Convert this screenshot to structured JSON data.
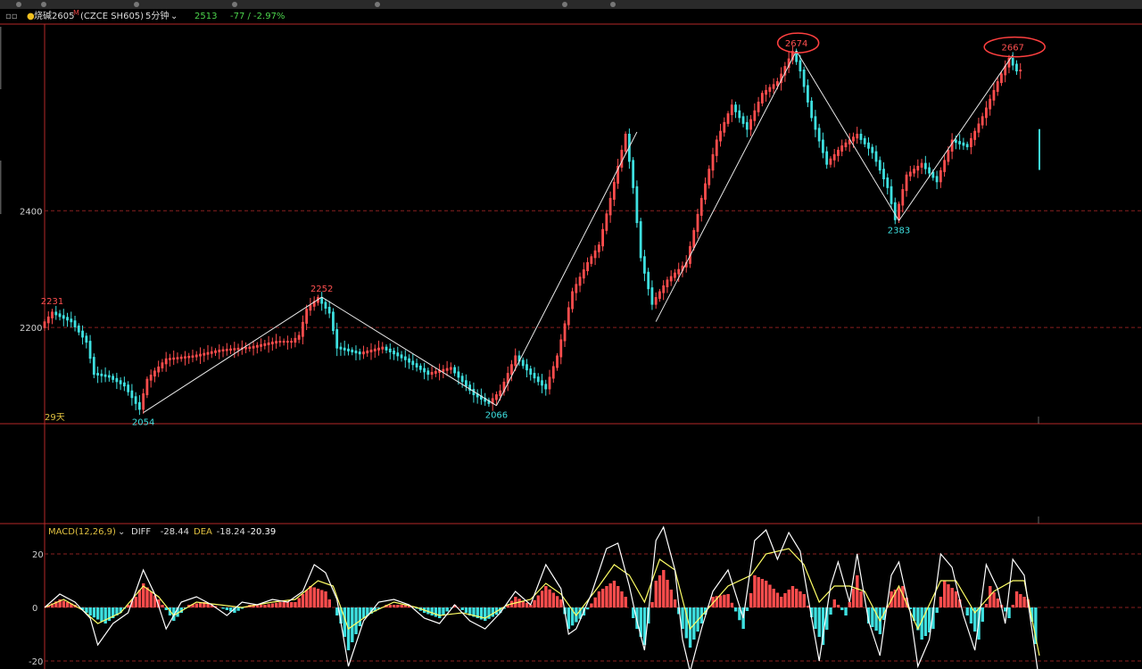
{
  "header": {
    "symbol": "烧碱2605",
    "warn_mark": "M",
    "code": "(CZCE SH605)",
    "period": "5分钟",
    "last_price": "2513",
    "change": "-77 / -2.97%"
  },
  "colors": {
    "up": "#ff4d4d",
    "down": "#3ee0e0",
    "diff_line": "#ffffff",
    "dea_line": "#ffff66",
    "border": "#b42828",
    "grid": "#8a1f1f"
  },
  "chart_data": [
    {
      "type": "candlestick",
      "title": "",
      "ylim": [
        2035,
        2720
      ],
      "y_ticks": [
        "2400",
        "2200"
      ],
      "note_label": "29天",
      "price_path": [
        [
          0,
          2200
        ],
        [
          3,
          2225
        ],
        [
          8,
          2210
        ],
        [
          12,
          2175
        ],
        [
          14,
          2120
        ],
        [
          18,
          2115
        ],
        [
          22,
          2100
        ],
        [
          26,
          2060
        ],
        [
          28,
          2110
        ],
        [
          33,
          2145
        ],
        [
          40,
          2150
        ],
        [
          47,
          2160
        ],
        [
          55,
          2165
        ],
        [
          62,
          2175
        ],
        [
          66,
          2175
        ],
        [
          68,
          2185
        ],
        [
          70,
          2230
        ],
        [
          73,
          2250
        ],
        [
          76,
          2225
        ],
        [
          78,
          2165
        ],
        [
          84,
          2155
        ],
        [
          90,
          2165
        ],
        [
          96,
          2145
        ],
        [
          102,
          2120
        ],
        [
          108,
          2130
        ],
        [
          114,
          2085
        ],
        [
          118,
          2070
        ],
        [
          121,
          2090
        ],
        [
          125,
          2150
        ],
        [
          129,
          2120
        ],
        [
          133,
          2095
        ],
        [
          136,
          2150
        ],
        [
          140,
          2260
        ],
        [
          144,
          2310
        ],
        [
          147,
          2340
        ],
        [
          150,
          2420
        ],
        [
          154,
          2530
        ],
        [
          156,
          2440
        ],
        [
          158,
          2320
        ],
        [
          161,
          2240
        ],
        [
          165,
          2280
        ],
        [
          170,
          2310
        ],
        [
          174,
          2420
        ],
        [
          178,
          2520
        ],
        [
          182,
          2580
        ],
        [
          186,
          2540
        ],
        [
          190,
          2600
        ],
        [
          194,
          2620
        ],
        [
          198,
          2672
        ],
        [
          200,
          2640
        ],
        [
          203,
          2560
        ],
        [
          207,
          2480
        ],
        [
          211,
          2510
        ],
        [
          215,
          2530
        ],
        [
          219,
          2500
        ],
        [
          223,
          2440
        ],
        [
          225,
          2385
        ],
        [
          228,
          2460
        ],
        [
          232,
          2480
        ],
        [
          236,
          2450
        ],
        [
          240,
          2520
        ],
        [
          244,
          2510
        ],
        [
          248,
          2560
        ],
        [
          252,
          2620
        ],
        [
          255,
          2660
        ],
        [
          257,
          2640
        ]
      ],
      "gap_point": [
        262,
        2510
      ],
      "markers": [
        {
          "label": "2231",
          "x": 2,
          "y": 2231,
          "kind": "high"
        },
        {
          "label": "2054",
          "x": 26,
          "y": 2054,
          "kind": "low"
        },
        {
          "label": "2252",
          "x": 73,
          "y": 2252,
          "kind": "high"
        },
        {
          "label": "2066",
          "x": 119,
          "y": 2066,
          "kind": "low"
        },
        {
          "label": "2674",
          "x": 198,
          "y": 2674,
          "kind": "high",
          "circled": true
        },
        {
          "label": "2383",
          "x": 225,
          "y": 2383,
          "kind": "low"
        },
        {
          "label": "2667",
          "x": 255,
          "y": 2667,
          "kind": "high",
          "circled": true
        }
      ],
      "trendlines": [
        [
          [
            26,
            2054
          ],
          [
            73,
            2252
          ]
        ],
        [
          [
            73,
            2252
          ],
          [
            119,
            2066
          ]
        ],
        [
          [
            119,
            2066
          ],
          [
            156,
            2535
          ]
        ],
        [
          [
            161,
            2210
          ],
          [
            198,
            2674
          ]
        ],
        [
          [
            198,
            2674
          ],
          [
            225,
            2383
          ]
        ],
        [
          [
            225,
            2383
          ],
          [
            255,
            2667
          ]
        ]
      ]
    },
    {
      "type": "line",
      "title": "MACD(12,26,9)",
      "legend": [
        {
          "name": "DIFF",
          "value": "-28.44"
        },
        {
          "name": "DEA",
          "value": "-18.24"
        },
        {
          "name": "",
          "value": "-20.39"
        }
      ],
      "ylim": [
        -23,
        31
      ],
      "y_ticks": [
        "20",
        "0",
        "-20"
      ],
      "diff_path": [
        [
          0,
          0
        ],
        [
          4,
          5
        ],
        [
          8,
          2
        ],
        [
          12,
          -4
        ],
        [
          14,
          -14
        ],
        [
          18,
          -6
        ],
        [
          22,
          -2
        ],
        [
          26,
          14
        ],
        [
          29,
          5
        ],
        [
          32,
          -8
        ],
        [
          36,
          2
        ],
        [
          40,
          4
        ],
        [
          44,
          1
        ],
        [
          48,
          -3
        ],
        [
          52,
          2
        ],
        [
          56,
          1
        ],
        [
          60,
          3
        ],
        [
          64,
          2
        ],
        [
          68,
          6
        ],
        [
          71,
          16
        ],
        [
          74,
          13
        ],
        [
          77,
          3
        ],
        [
          80,
          -22
        ],
        [
          84,
          -5
        ],
        [
          88,
          2
        ],
        [
          92,
          3
        ],
        [
          96,
          1
        ],
        [
          100,
          -4
        ],
        [
          104,
          -6
        ],
        [
          108,
          1
        ],
        [
          112,
          -5
        ],
        [
          116,
          -8
        ],
        [
          120,
          -2
        ],
        [
          124,
          6
        ],
        [
          128,
          1
        ],
        [
          132,
          16
        ],
        [
          136,
          7
        ],
        [
          138,
          -10
        ],
        [
          140,
          -8
        ],
        [
          144,
          5
        ],
        [
          148,
          22
        ],
        [
          151,
          24
        ],
        [
          154,
          8
        ],
        [
          156,
          -5
        ],
        [
          158,
          -16
        ],
        [
          161,
          25
        ],
        [
          163,
          30
        ],
        [
          166,
          14
        ],
        [
          168,
          -12
        ],
        [
          170,
          -24
        ],
        [
          173,
          -8
        ],
        [
          176,
          6
        ],
        [
          180,
          14
        ],
        [
          184,
          -4
        ],
        [
          187,
          25
        ],
        [
          190,
          29
        ],
        [
          193,
          18
        ],
        [
          196,
          28
        ],
        [
          199,
          21
        ],
        [
          202,
          -4
        ],
        [
          204,
          -20
        ],
        [
          207,
          8
        ],
        [
          209,
          17
        ],
        [
          212,
          2
        ],
        [
          214,
          20
        ],
        [
          217,
          -5
        ],
        [
          220,
          -18
        ],
        [
          223,
          12
        ],
        [
          225,
          17
        ],
        [
          228,
          -2
        ],
        [
          230,
          -22
        ],
        [
          233,
          -12
        ],
        [
          236,
          20
        ],
        [
          239,
          15
        ],
        [
          242,
          -3
        ],
        [
          245,
          -16
        ],
        [
          248,
          16
        ],
        [
          251,
          7
        ],
        [
          253,
          -6
        ],
        [
          255,
          18
        ],
        [
          258,
          12
        ],
        [
          262,
          -28
        ]
      ],
      "dea_path": [
        [
          0,
          0
        ],
        [
          5,
          3
        ],
        [
          10,
          -1
        ],
        [
          14,
          -6
        ],
        [
          20,
          -2
        ],
        [
          26,
          8
        ],
        [
          30,
          4
        ],
        [
          34,
          -3
        ],
        [
          40,
          2
        ],
        [
          46,
          1
        ],
        [
          52,
          0
        ],
        [
          60,
          2
        ],
        [
          66,
          3
        ],
        [
          72,
          10
        ],
        [
          76,
          8
        ],
        [
          80,
          -8
        ],
        [
          86,
          -2
        ],
        [
          92,
          2
        ],
        [
          98,
          0
        ],
        [
          104,
          -3
        ],
        [
          110,
          -2
        ],
        [
          116,
          -4
        ],
        [
          122,
          1
        ],
        [
          128,
          3
        ],
        [
          132,
          9
        ],
        [
          136,
          5
        ],
        [
          140,
          -3
        ],
        [
          146,
          8
        ],
        [
          150,
          16
        ],
        [
          154,
          12
        ],
        [
          158,
          2
        ],
        [
          162,
          18
        ],
        [
          166,
          14
        ],
        [
          170,
          -8
        ],
        [
          175,
          0
        ],
        [
          180,
          8
        ],
        [
          186,
          12
        ],
        [
          190,
          20
        ],
        [
          196,
          22
        ],
        [
          200,
          16
        ],
        [
          204,
          2
        ],
        [
          208,
          8
        ],
        [
          212,
          8
        ],
        [
          216,
          6
        ],
        [
          220,
          -5
        ],
        [
          225,
          8
        ],
        [
          230,
          -8
        ],
        [
          236,
          10
        ],
        [
          240,
          10
        ],
        [
          245,
          -2
        ],
        [
          250,
          6
        ],
        [
          255,
          10
        ],
        [
          258,
          10
        ],
        [
          262,
          -18
        ]
      ],
      "hist_path": [
        [
          0,
          0
        ],
        [
          4,
          3
        ],
        [
          8,
          1
        ],
        [
          12,
          -3
        ],
        [
          16,
          -6
        ],
        [
          20,
          -2
        ],
        [
          24,
          4
        ],
        [
          26,
          9
        ],
        [
          30,
          3
        ],
        [
          34,
          -5
        ],
        [
          38,
          1
        ],
        [
          42,
          2
        ],
        [
          46,
          0
        ],
        [
          50,
          -2
        ],
        [
          54,
          1
        ],
        [
          58,
          1
        ],
        [
          62,
          2
        ],
        [
          66,
          2
        ],
        [
          70,
          8
        ],
        [
          74,
          6
        ],
        [
          78,
          -6
        ],
        [
          80,
          -16
        ],
        [
          84,
          -4
        ],
        [
          90,
          1
        ],
        [
          96,
          1
        ],
        [
          100,
          -2
        ],
        [
          104,
          -4
        ],
        [
          108,
          1
        ],
        [
          112,
          -3
        ],
        [
          116,
          -5
        ],
        [
          120,
          -2
        ],
        [
          124,
          4
        ],
        [
          128,
          1
        ],
        [
          132,
          8
        ],
        [
          136,
          3
        ],
        [
          138,
          -8
        ],
        [
          142,
          -3
        ],
        [
          146,
          6
        ],
        [
          150,
          10
        ],
        [
          153,
          4
        ],
        [
          156,
          -8
        ],
        [
          158,
          -14
        ],
        [
          161,
          10
        ],
        [
          163,
          14
        ],
        [
          166,
          3
        ],
        [
          168,
          -8
        ],
        [
          170,
          -15
        ],
        [
          173,
          -6
        ],
        [
          176,
          4
        ],
        [
          180,
          5
        ],
        [
          184,
          -8
        ],
        [
          187,
          12
        ],
        [
          190,
          10
        ],
        [
          194,
          4
        ],
        [
          197,
          8
        ],
        [
          200,
          5
        ],
        [
          203,
          -8
        ],
        [
          205,
          -14
        ],
        [
          208,
          3
        ],
        [
          211,
          -3
        ],
        [
          214,
          12
        ],
        [
          217,
          -6
        ],
        [
          220,
          -10
        ],
        [
          223,
          6
        ],
        [
          226,
          8
        ],
        [
          229,
          -5
        ],
        [
          231,
          -12
        ],
        [
          234,
          -8
        ],
        [
          237,
          10
        ],
        [
          240,
          6
        ],
        [
          243,
          -3
        ],
        [
          246,
          -12
        ],
        [
          249,
          8
        ],
        [
          252,
          1
        ],
        [
          254,
          -4
        ],
        [
          256,
          6
        ],
        [
          259,
          3
        ],
        [
          262,
          -22
        ]
      ]
    }
  ]
}
